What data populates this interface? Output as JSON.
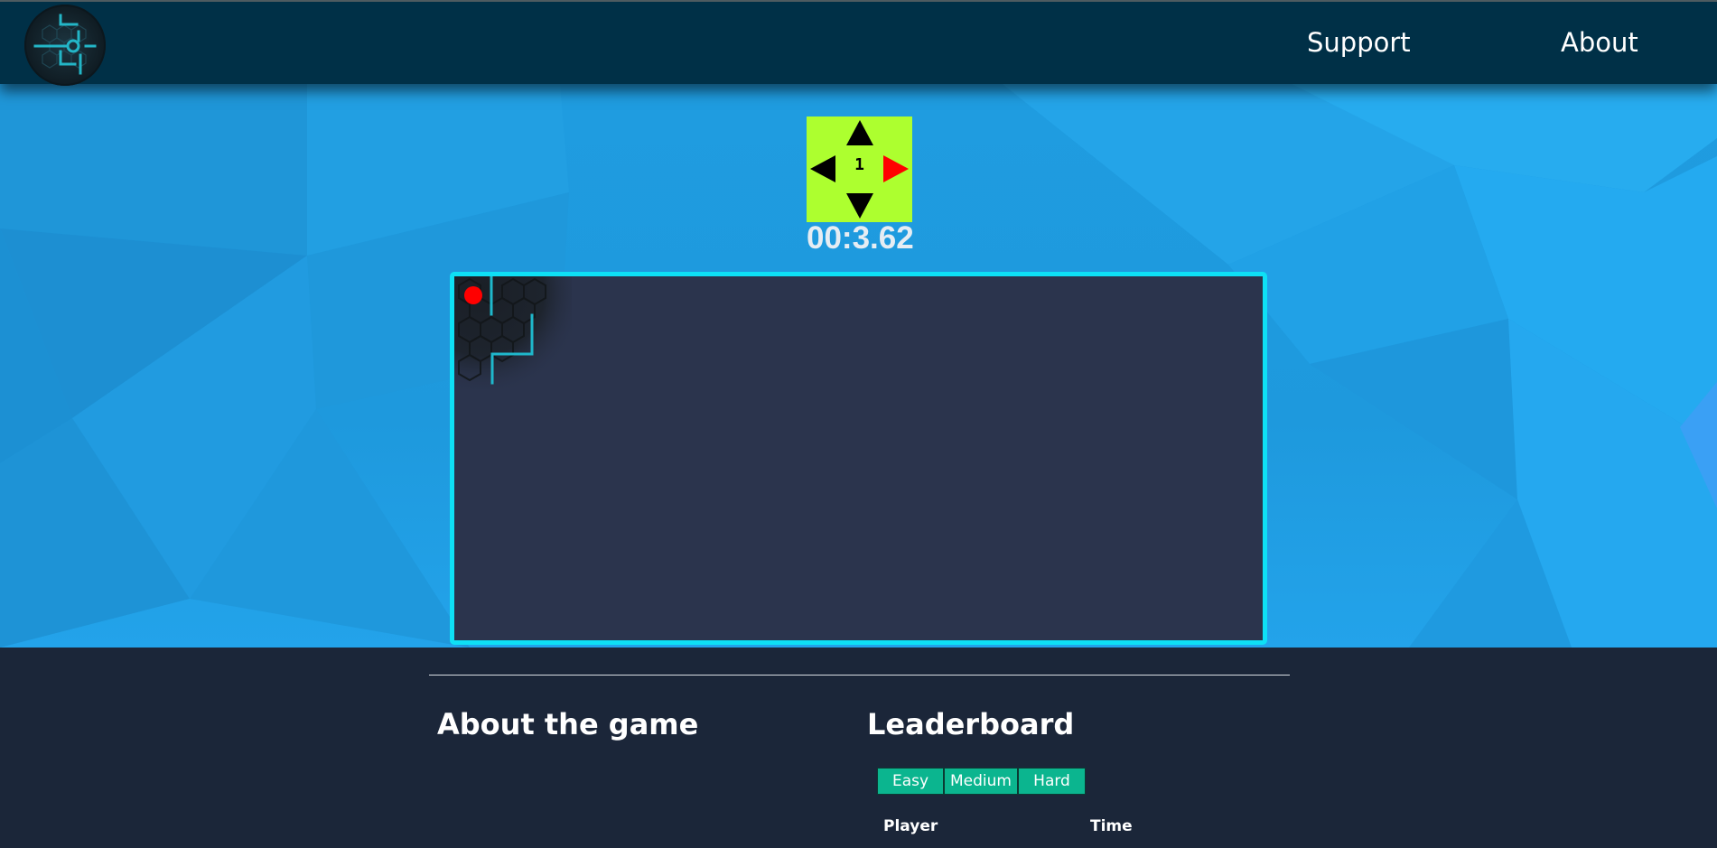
{
  "header": {
    "nav": {
      "support": "Support",
      "about": "About"
    }
  },
  "game": {
    "move_counter": "1",
    "timer": "00:3.62",
    "active_direction": "right",
    "colors": {
      "pad": "#adff2f",
      "active_arrow": "#ff0000",
      "board_border": "#0ee0f5",
      "board_bg": "#2b344d",
      "player_dot": "#ff0000"
    }
  },
  "footer": {
    "about_title": "About the game",
    "leaderboard": {
      "title": "Leaderboard",
      "tabs": [
        "Easy",
        "Medium",
        "Hard"
      ],
      "columns": [
        "Player",
        "Time"
      ]
    }
  }
}
